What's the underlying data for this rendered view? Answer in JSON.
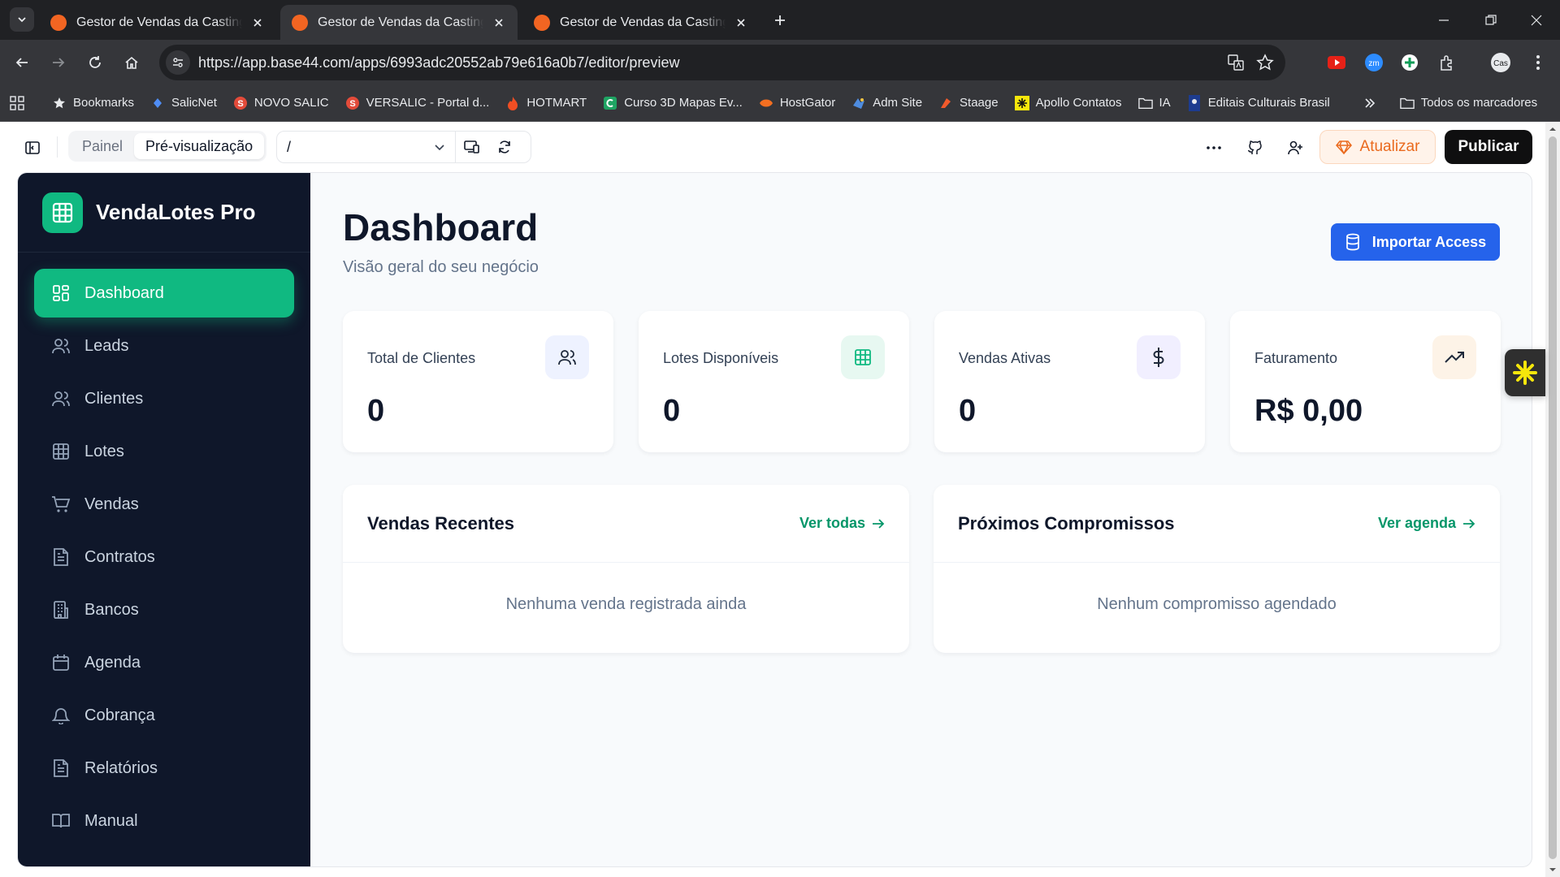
{
  "browser": {
    "tabs": [
      {
        "title": "Gestor de Vendas da Casting Eventos",
        "active": false
      },
      {
        "title": "Gestor de Vendas da Casting Eventos",
        "active": true
      },
      {
        "title": "Gestor de Vendas da Casting Eventos",
        "active": false
      }
    ],
    "url": "https://app.base44.com/apps/6993adc20552ab79e616a0b7/editor/preview",
    "bookmarks": [
      {
        "label": "Bookmarks",
        "icon": "star-icon"
      },
      {
        "label": "SalicNet",
        "icon": "salicnet-icon"
      },
      {
        "label": "NOVO SALIC",
        "icon": "salic-icon"
      },
      {
        "label": "VERSALIC - Portal d...",
        "icon": "salic-icon"
      },
      {
        "label": "HOTMART",
        "icon": "hotmart-icon"
      },
      {
        "label": "Curso 3D Mapas Ev...",
        "icon": "curso-icon"
      },
      {
        "label": "HostGator",
        "icon": "hostgator-icon"
      },
      {
        "label": "Adm Site",
        "icon": "adm-icon"
      },
      {
        "label": "Staage",
        "icon": "staage-icon"
      },
      {
        "label": "Apollo Contatos",
        "icon": "apollo-icon"
      },
      {
        "label": "IA",
        "icon": "folder-icon"
      },
      {
        "label": "Editais Culturais Brasil",
        "icon": "editais-icon"
      }
    ],
    "all_bookmarks": "Todos os marcadores"
  },
  "editor": {
    "tab_painel": "Painel",
    "tab_preview": "Pré-visualização",
    "path": "/",
    "upgrade_label": "Atualizar",
    "publish_label": "Publicar"
  },
  "app": {
    "brand": "VendaLotes Pro",
    "nav": [
      {
        "label": "Dashboard",
        "icon": "dashboard-icon",
        "active": true
      },
      {
        "label": "Leads",
        "icon": "users-icon"
      },
      {
        "label": "Clientes",
        "icon": "users-icon"
      },
      {
        "label": "Lotes",
        "icon": "grid-icon"
      },
      {
        "label": "Vendas",
        "icon": "cart-icon"
      },
      {
        "label": "Contratos",
        "icon": "file-icon"
      },
      {
        "label": "Bancos",
        "icon": "bank-icon"
      },
      {
        "label": "Agenda",
        "icon": "calendar-icon"
      },
      {
        "label": "Cobrança",
        "icon": "bell-icon"
      },
      {
        "label": "Relatórios",
        "icon": "file-icon"
      },
      {
        "label": "Manual",
        "icon": "book-icon"
      }
    ],
    "title": "Dashboard",
    "subtitle": "Visão geral do seu negócio",
    "import_label": "Importar Access",
    "stats": [
      {
        "label": "Total de Clientes",
        "value": "0",
        "icon": "users-icon",
        "bg": "#eef2ff",
        "fg": "#1e293b"
      },
      {
        "label": "Lotes Disponíveis",
        "value": "0",
        "icon": "grid-icon",
        "bg": "#e7f8f1",
        "fg": "#10b981"
      },
      {
        "label": "Vendas Ativas",
        "value": "0",
        "icon": "dollar-icon",
        "bg": "#f1efff",
        "fg": "#1e293b"
      },
      {
        "label": "Faturamento",
        "value": "R$ 0,00",
        "icon": "trending-up-icon",
        "bg": "#fdf3e7",
        "fg": "#1e293b"
      }
    ],
    "recent_sales": {
      "title": "Vendas Recentes",
      "link": "Ver todas",
      "empty": "Nenhuma venda registrada ainda"
    },
    "appointments": {
      "title": "Próximos Compromissos",
      "link": "Ver agenda",
      "empty": "Nenhum compromisso agendado"
    }
  },
  "colors": {
    "accent": "#10b981",
    "primary": "#2563eb",
    "sidebar": "#0f172a"
  }
}
